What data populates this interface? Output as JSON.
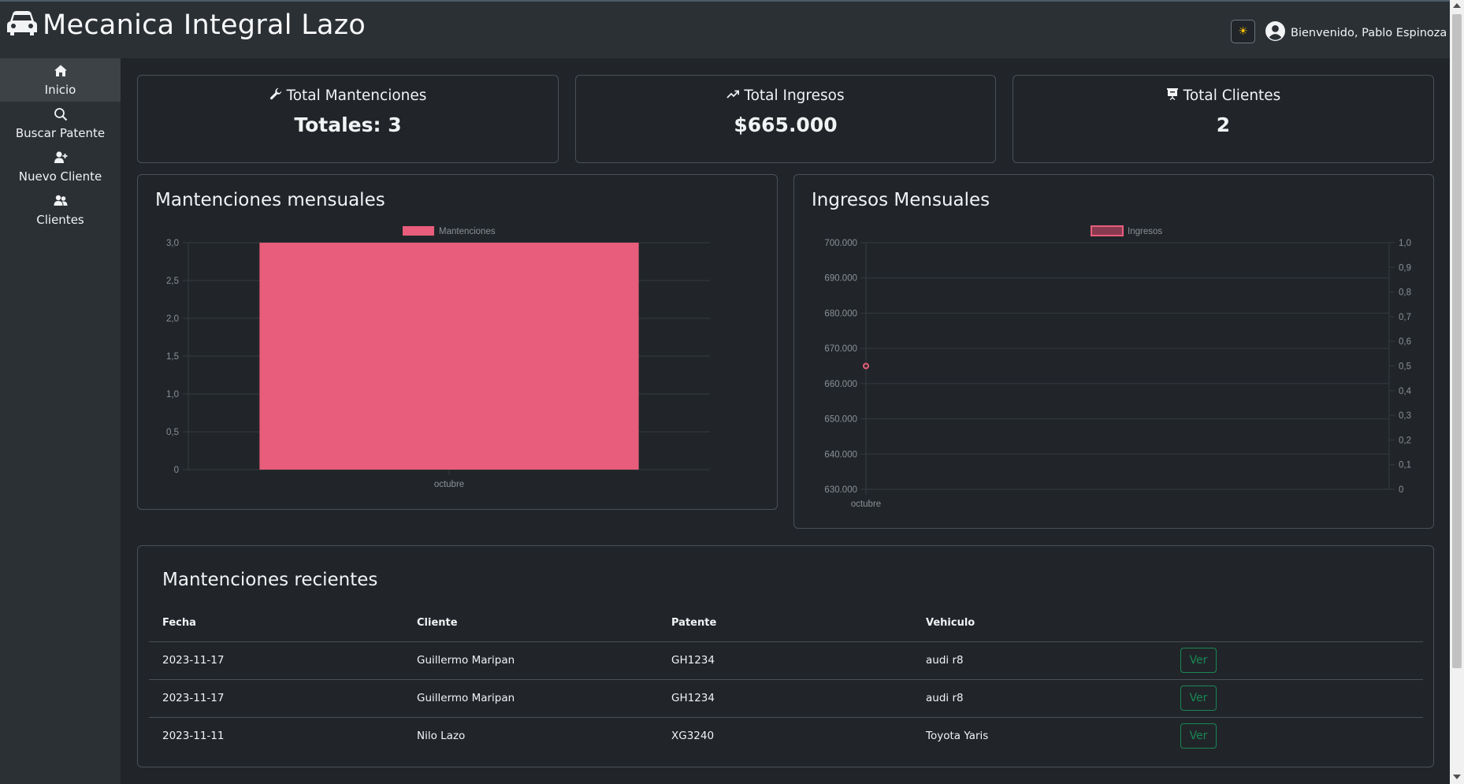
{
  "header": {
    "app_title": "Mecanica Integral Lazo",
    "theme_toggle": "☀",
    "welcome": "Bienvenido, Pablo Espinoza"
  },
  "sidebar": {
    "items": [
      {
        "label": "Inicio",
        "icon": "home-icon",
        "active": true
      },
      {
        "label": "Buscar Patente",
        "icon": "search-icon",
        "active": false
      },
      {
        "label": "Nuevo Cliente",
        "icon": "user-plus-icon",
        "active": false
      },
      {
        "label": "Clientes",
        "icon": "users-icon",
        "active": false
      }
    ]
  },
  "stats": [
    {
      "title": "Total Mantenciones",
      "value": "Totales: 3",
      "icon": "wrench-icon"
    },
    {
      "title": "Total Ingresos",
      "value": "$665.000",
      "icon": "trending-up-icon"
    },
    {
      "title": "Total Clientes",
      "value": "2",
      "icon": "presentation-icon"
    }
  ],
  "colors": {
    "bar": "#e85d7b",
    "accent_success": "#198754",
    "theme_icon": "#ffc107"
  },
  "chart_data": [
    {
      "type": "bar",
      "title": "Mantenciones mensuales",
      "categories": [
        "octubre"
      ],
      "series": [
        {
          "name": "Mantenciones",
          "values": [
            3
          ]
        }
      ],
      "ylim": [
        0,
        3
      ],
      "yticks": [
        "0",
        "0,5",
        "1,0",
        "1,5",
        "2,0",
        "2,5",
        "3,0"
      ],
      "legend": "top"
    },
    {
      "type": "line",
      "title": "Ingresos Mensuales",
      "categories": [
        "octubre"
      ],
      "series": [
        {
          "name": "Ingresos",
          "values": [
            665000
          ]
        }
      ],
      "ylim": [
        630000,
        700000
      ],
      "yticks": [
        "630.000",
        "640.000",
        "650.000",
        "660.000",
        "670.000",
        "680.000",
        "690.000",
        "700.000"
      ],
      "y2ticks": [
        "0",
        "0,1",
        "0,2",
        "0,3",
        "0,4",
        "0,5",
        "0,6",
        "0,7",
        "0,8",
        "0,9",
        "1,0"
      ],
      "legend": "top"
    }
  ],
  "recent": {
    "title": "Mantenciones recientes",
    "headers": [
      "Fecha",
      "Cliente",
      "Patente",
      "Vehiculo"
    ],
    "button_label": "Ver",
    "rows": [
      {
        "fecha": "2023-11-17",
        "cliente": "Guillermo Maripan",
        "patente": "GH1234",
        "vehiculo": "audi r8"
      },
      {
        "fecha": "2023-11-17",
        "cliente": "Guillermo Maripan",
        "patente": "GH1234",
        "vehiculo": "audi r8"
      },
      {
        "fecha": "2023-11-11",
        "cliente": "Nilo Lazo",
        "patente": "XG3240",
        "vehiculo": "Toyota Yaris"
      }
    ]
  }
}
